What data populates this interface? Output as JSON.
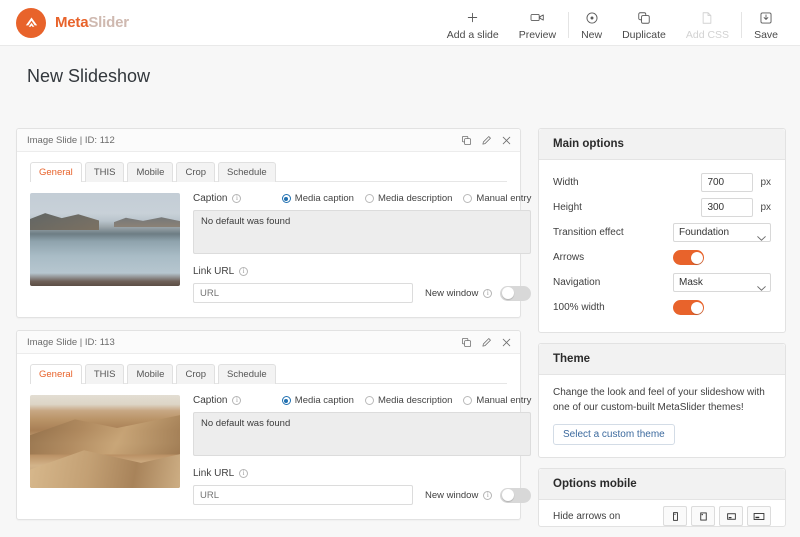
{
  "topbar": {
    "brand_meta": "Meta",
    "brand_slider": "Slider",
    "logo_icon": "metaslider-chevron-logo-icon",
    "tools": [
      {
        "label": "Add a slide",
        "icon": "plus-icon",
        "disabled": false
      },
      {
        "label": "Preview",
        "icon": "video-camera-icon",
        "disabled": false
      },
      {
        "label": "New",
        "icon": "circle-dot-icon",
        "disabled": false
      },
      {
        "label": "Duplicate",
        "icon": "copy-icon",
        "disabled": false
      },
      {
        "label": "Add CSS",
        "icon": "css-file-icon",
        "disabled": true
      },
      {
        "label": "Save",
        "icon": "save-download-icon",
        "disabled": false
      }
    ]
  },
  "page": {
    "title": "New Slideshow"
  },
  "slides": [
    {
      "header": "Image Slide | ID: 112",
      "actions": [
        "copy-icon",
        "pencil-icon",
        "close-icon"
      ],
      "tabs": [
        {
          "label": "General",
          "active": true
        },
        {
          "label": "THIS",
          "active": false
        },
        {
          "label": "Mobile",
          "active": false
        },
        {
          "label": "Crop",
          "active": false
        },
        {
          "label": "Schedule",
          "active": false
        }
      ],
      "thumb_alt": "lake-mountain-landscape-thumbnail",
      "caption_label": "Caption",
      "caption_options": [
        {
          "label": "Media caption",
          "checked": true
        },
        {
          "label": "Media description",
          "checked": false
        },
        {
          "label": "Manual entry",
          "checked": false
        }
      ],
      "caption_value": "No default was found",
      "link_label": "Link URL",
      "link_placeholder": "URL",
      "link_value": "",
      "new_window_label": "New window",
      "new_window_on": false
    },
    {
      "header": "Image Slide | ID: 113",
      "actions": [
        "copy-icon",
        "pencil-icon",
        "close-icon"
      ],
      "tabs": [
        {
          "label": "General",
          "active": true
        },
        {
          "label": "THIS",
          "active": false
        },
        {
          "label": "Mobile",
          "active": false
        },
        {
          "label": "Crop",
          "active": false
        },
        {
          "label": "Schedule",
          "active": false
        }
      ],
      "thumb_alt": "desert-sand-dunes-thumbnail",
      "caption_label": "Caption",
      "caption_options": [
        {
          "label": "Media caption",
          "checked": true
        },
        {
          "label": "Media description",
          "checked": false
        },
        {
          "label": "Manual entry",
          "checked": false
        }
      ],
      "caption_value": "No default was found",
      "link_label": "Link URL",
      "link_placeholder": "URL",
      "link_value": "",
      "new_window_label": "New window",
      "new_window_on": false
    }
  ],
  "sidebar": {
    "main_options": {
      "title": "Main options",
      "width_label": "Width",
      "width_value": "700",
      "width_unit": "px",
      "height_label": "Height",
      "height_value": "300",
      "height_unit": "px",
      "transition_label": "Transition effect",
      "transition_value": "Foundation",
      "arrows_label": "Arrows",
      "arrows_on": true,
      "navigation_label": "Navigation",
      "navigation_value": "Mask",
      "full_width_label": "100% width",
      "full_width_on": true
    },
    "theme": {
      "title": "Theme",
      "description": "Change the look and feel of your slideshow with one of our custom-built MetaSlider themes!",
      "button_label": "Select a custom theme"
    },
    "options_mobile": {
      "title": "Options mobile",
      "hide_arrows_label": "Hide arrows on",
      "devices": [
        "mobile-icon",
        "tablet-icon",
        "laptop-icon",
        "desktop-icon"
      ]
    }
  },
  "colors": {
    "accent": "#e8632b",
    "radio_blue": "#2271b1",
    "link_blue": "#3c6a9e"
  }
}
